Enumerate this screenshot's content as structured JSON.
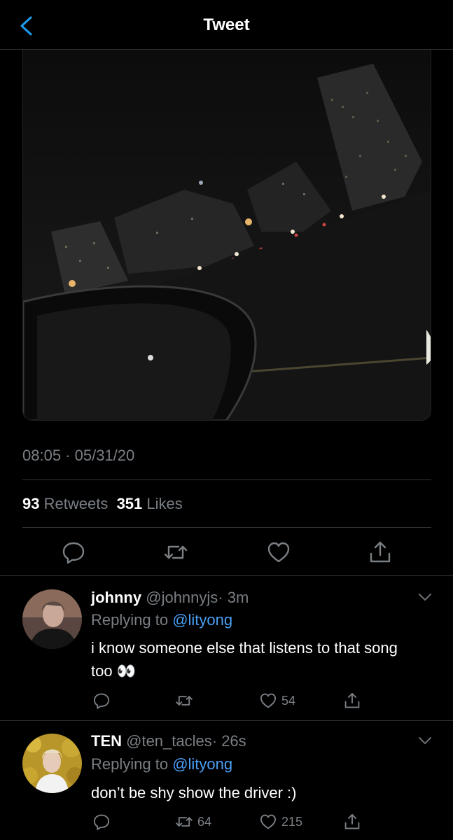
{
  "header": {
    "title": "Tweet",
    "back_icon": "chevron-left-icon"
  },
  "tweet": {
    "timestamp": "08:05 · 05/31/20",
    "retweets_count": "93",
    "retweets_label": "Retweets",
    "likes_count": "351",
    "likes_label": "Likes"
  },
  "replies": [
    {
      "name": "johnny",
      "handle": "@johnnyjs",
      "time": "· 3m",
      "replying_label": "Replying to",
      "replying_to": "@lityong",
      "text": "i know someone else that listens to that song too 👀",
      "retweets": "",
      "likes": "54"
    },
    {
      "name": "TEN",
      "handle": "@ten_tacles",
      "time": "· 26s",
      "replying_label": "Replying to",
      "replying_to": "@lityong",
      "text": "don’t be shy show the driver :)",
      "retweets": "64",
      "likes": "215"
    }
  ],
  "colors": {
    "accent": "#4a9ff5",
    "muted": "#7a7f84",
    "background": "#000000"
  }
}
